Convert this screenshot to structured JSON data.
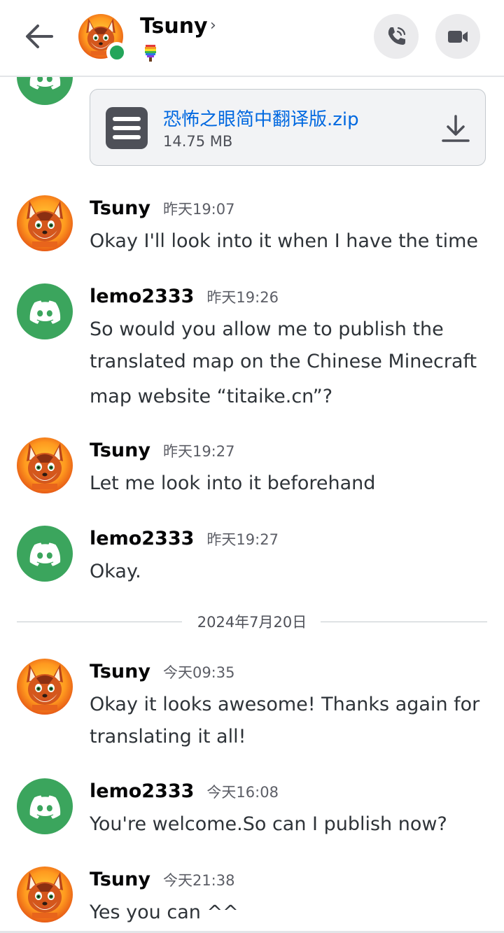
{
  "header": {
    "title": "Tsuny",
    "chevron": "›",
    "back_icon": "arrow-left-icon",
    "call_icon": "phone-icon",
    "video_icon": "video-camera-icon",
    "status_emoji": "rainbow-ice-cream"
  },
  "attachment": {
    "file_name": "恐怖之眼简中翻译版.zip",
    "file_size": "14.75 MB",
    "icon": "file-icon",
    "download_icon": "download-icon"
  },
  "messages": [
    {
      "author": "Tsuny",
      "time": "昨天19:07",
      "text": "Okay I'll look into it when I have the time"
    },
    {
      "author": "lemo2333",
      "time": "昨天19:26",
      "text_lines": [
        "So would you allow me to publish the",
        "translated map on the Chinese Minecraft",
        "map website “titaike.cn”?"
      ]
    },
    {
      "author": "Tsuny",
      "time": "昨天19:27",
      "text": "Let me look into it beforehand"
    },
    {
      "author": "lemo2333",
      "time": "昨天19:27",
      "text": "Okay."
    },
    {
      "author": "Tsuny",
      "time": "今天09:35",
      "text_lines": [
        "Okay it looks awesome! Thanks again for",
        "translating it all!"
      ]
    },
    {
      "author": "lemo2333",
      "time": "今天16:08",
      "text": "You're welcome.So can I publish now?"
    },
    {
      "author": "Tsuny",
      "time": "今天21:38",
      "text": "Yes you can ^^"
    }
  ],
  "date_divider": "2024年7月20日",
  "colors": {
    "discord_green": "#3ba55d",
    "online": "#23a55a",
    "link": "#0068e0",
    "fox_orange": "#e8641c"
  }
}
